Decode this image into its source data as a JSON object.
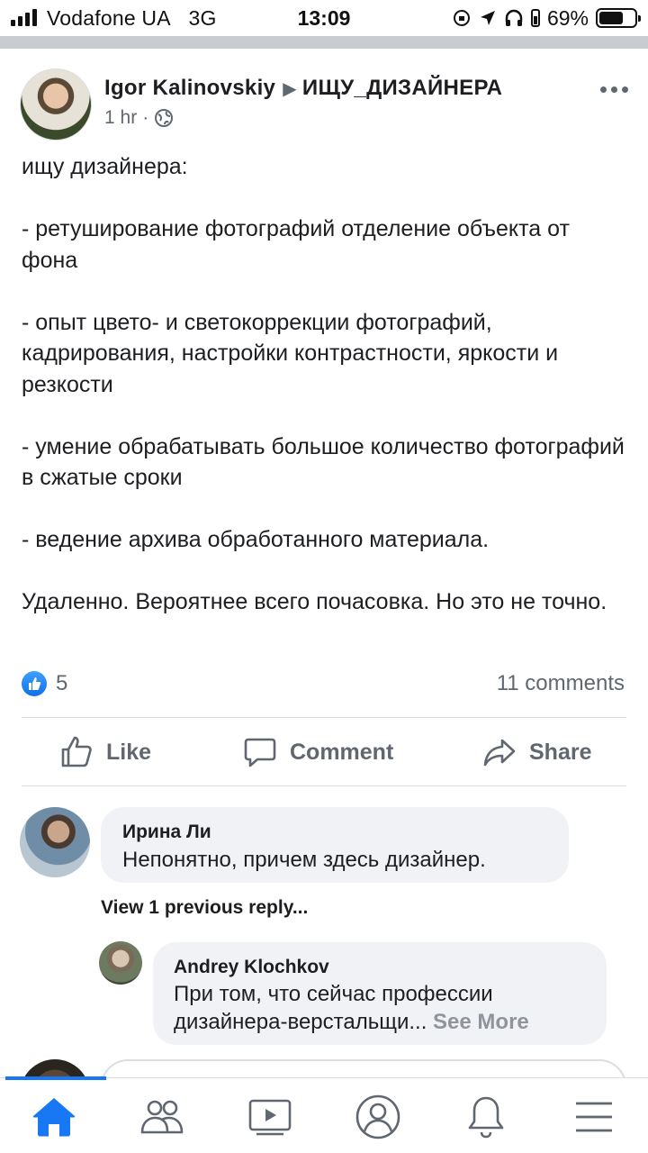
{
  "status_bar": {
    "carrier": "Vodafone UA",
    "network": "3G",
    "time": "13:09",
    "battery_percent": "69%",
    "battery_level": 0.69
  },
  "post": {
    "author": "Igor  Kalinovskiy",
    "group": "ИЩУ_ДИЗАЙНЕРА",
    "time": "1 hr",
    "separator": "·",
    "audience_icon": "globe-icon",
    "body": [
      "ищу дизайнера:",
      "",
      "- ретуширование фотографий отделение объекта от фона",
      "",
      "- опыт цвето- и светокоррекции фотографий, кадрирования, настройки контрастности, яркости и резкости",
      "",
      "- умение обрабатывать большое количество фотографий в сжатые сроки",
      "",
      "- ведение архива обработанного материала.",
      "",
      "Удаленно. Вероятнее всего почасовка. Но это не точно."
    ],
    "like_count": "5",
    "comment_count": "11 comments"
  },
  "actions": {
    "like": "Like",
    "comment": "Comment",
    "share": "Share"
  },
  "comments": {
    "first": {
      "author": "Ирина Ли",
      "text": "Непонятно, причем здесь дизайнер."
    },
    "view_replies": "View 1 previous reply...",
    "reply": {
      "author": "Andrey Klochkov",
      "text_line1": "При том, что сейчас профессии",
      "text_line2": "дизайнера-верстальщи...",
      "see_more": "See More"
    }
  },
  "tab_bar": {
    "active": "home",
    "tabs": [
      "home-icon",
      "groups-icon",
      "watch-icon",
      "profile-icon",
      "notifications-icon",
      "menu-icon"
    ]
  },
  "colors": {
    "accent": "#1877f2",
    "text_primary": "#1c1e21",
    "text_secondary": "#606770",
    "bubble": "#f0f2f5",
    "divider": "#dadde1"
  }
}
